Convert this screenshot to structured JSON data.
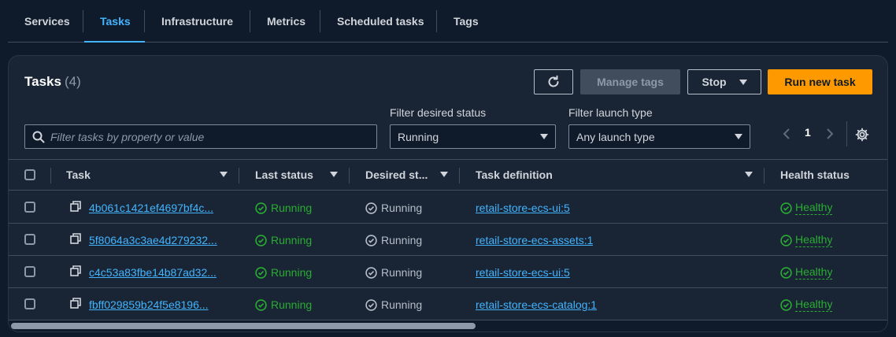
{
  "tabs": [
    {
      "label": "Services"
    },
    {
      "label": "Tasks"
    },
    {
      "label": "Infrastructure"
    },
    {
      "label": "Metrics"
    },
    {
      "label": "Scheduled tasks"
    },
    {
      "label": "Tags"
    }
  ],
  "header": {
    "title": "Tasks",
    "count": "(4)",
    "refresh_icon": "refresh-icon",
    "manage_tags_label": "Manage tags",
    "stop_label": "Stop",
    "run_label": "Run new task"
  },
  "filters": {
    "search_placeholder": "Filter tasks by property or value",
    "desired_status_label": "Filter desired status",
    "desired_status_value": "Running",
    "launch_type_label": "Filter launch type",
    "launch_type_value": "Any launch type"
  },
  "pagination": {
    "current_page": "1"
  },
  "table": {
    "columns": [
      "Task",
      "Last status",
      "Desired st...",
      "Task definition",
      "Health status"
    ],
    "rows": [
      {
        "task": "4b061c1421ef4697bf4c...",
        "last_status": "Running",
        "desired_status": "Running",
        "task_definition": "retail-store-ecs-ui:5",
        "health": "Healthy"
      },
      {
        "task": "5f8064a3c3ae4d279232...",
        "last_status": "Running",
        "desired_status": "Running",
        "task_definition": "retail-store-ecs-assets:1",
        "health": "Healthy"
      },
      {
        "task": "c4c53a83fbe14b87ad32...",
        "last_status": "Running",
        "desired_status": "Running",
        "task_definition": "retail-store-ecs-ui:5",
        "health": "Healthy"
      },
      {
        "task": "fbff029859b24f5e8196...",
        "last_status": "Running",
        "desired_status": "Running",
        "task_definition": "retail-store-ecs-catalog:1",
        "health": "Healthy"
      }
    ]
  },
  "colors": {
    "background": "#0f1b2a",
    "panel": "#192534",
    "accent_blue": "#42b4ff",
    "primary_orange": "#ff9900",
    "success_green": "#29ad32"
  }
}
